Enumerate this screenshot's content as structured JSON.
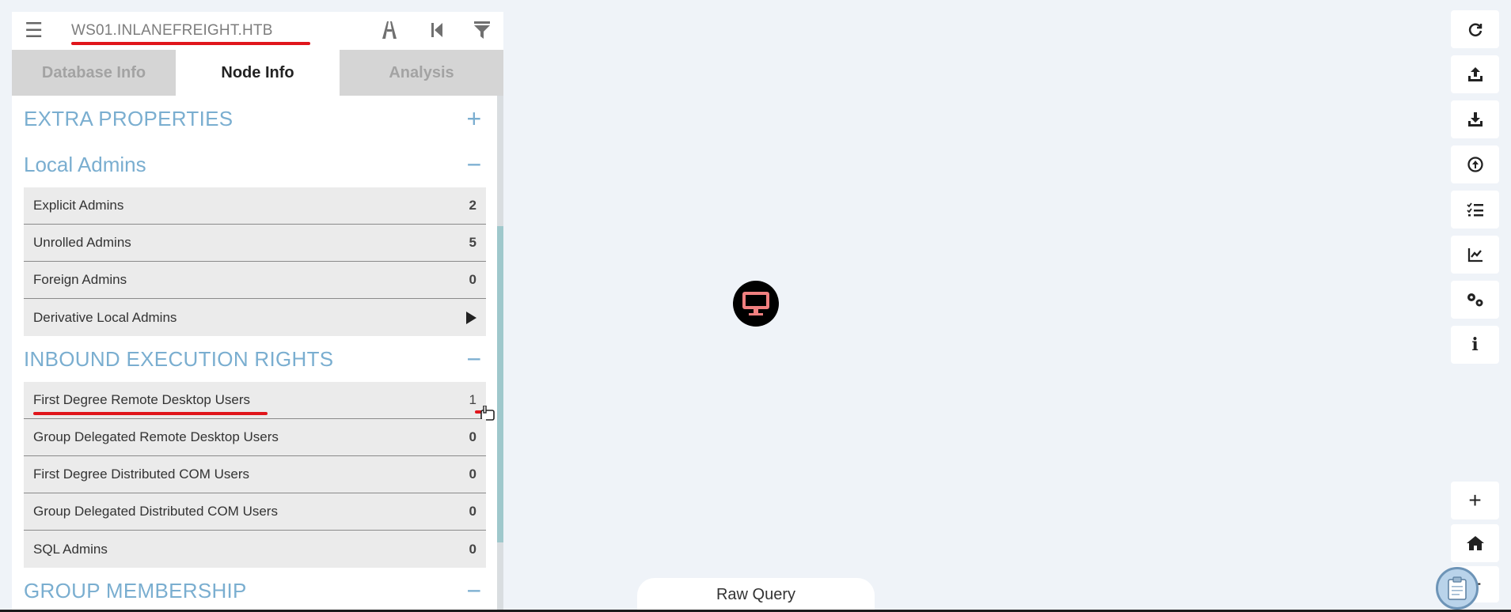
{
  "search": {
    "value": "WS01.INLANEFREIGHT.HTB"
  },
  "tabs": [
    {
      "label": "Database Info"
    },
    {
      "label": "Node Info"
    },
    {
      "label": "Analysis"
    }
  ],
  "sections": {
    "extra_properties": {
      "title": "EXTRA PROPERTIES",
      "toggle": "+"
    },
    "local_admins": {
      "title": "Local Admins",
      "toggle": "−",
      "rows": [
        {
          "label": "Explicit Admins",
          "value": "2"
        },
        {
          "label": "Unrolled Admins",
          "value": "5"
        },
        {
          "label": "Foreign Admins",
          "value": "0"
        },
        {
          "label": "Derivative Local Admins"
        }
      ]
    },
    "inbound_execution": {
      "title": "INBOUND EXECUTION RIGHTS",
      "toggle": "−",
      "rows": [
        {
          "label": "First Degree Remote Desktop Users",
          "value": "1"
        },
        {
          "label": "Group Delegated Remote Desktop Users",
          "value": "0"
        },
        {
          "label": "First Degree Distributed COM Users",
          "value": "0"
        },
        {
          "label": "Group Delegated Distributed COM Users",
          "value": "0"
        },
        {
          "label": "SQL Admins",
          "value": "0"
        }
      ]
    },
    "group_membership": {
      "title": "GROUP MEMBERSHIP",
      "toggle": "−"
    }
  },
  "toolbar_icons": [
    "refresh-icon",
    "upload-icon",
    "download-icon",
    "arrow-up-circle-icon",
    "checklist-icon",
    "chart-line-icon",
    "settings-icon",
    "info-icon"
  ],
  "info_glyph": "i",
  "zoom_controls": {
    "plus": "+",
    "minus": "−"
  },
  "raw_query": {
    "label": "Raw Query"
  },
  "colors": {
    "accent": "#7aaed0",
    "annotation": "#e0151b",
    "background": "#eff3f8",
    "node_icon": "#f08080"
  }
}
